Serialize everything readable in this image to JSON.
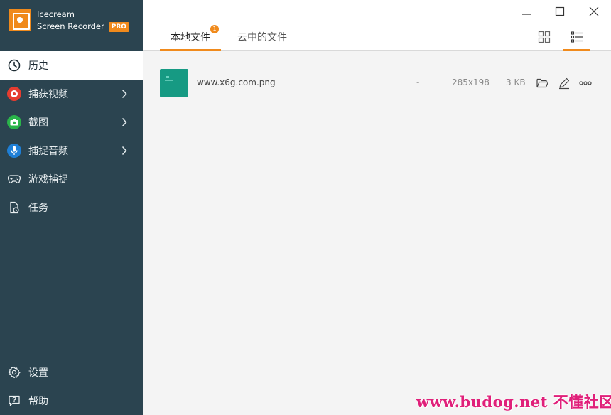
{
  "app": {
    "name_line1": "Icecream",
    "name_line2": "Screen Recorder",
    "pro_badge": "PRO"
  },
  "sidebar": {
    "items": [
      {
        "label": "历史",
        "icon": "clock-icon",
        "active": true
      },
      {
        "label": "捕获视频",
        "icon": "record-icon",
        "color": "#e63c2f",
        "has_submenu": true
      },
      {
        "label": "截图",
        "icon": "camera-icon",
        "color": "#2ab44a",
        "has_submenu": true
      },
      {
        "label": "捕捉音频",
        "icon": "microphone-icon",
        "color": "#1e7fd6",
        "has_submenu": true
      },
      {
        "label": "游戏捕捉",
        "icon": "gamepad-icon"
      },
      {
        "label": "任务",
        "icon": "task-icon"
      }
    ],
    "bottom_items": [
      {
        "label": "设置",
        "icon": "gear-icon"
      },
      {
        "label": "帮助",
        "icon": "help-icon"
      }
    ]
  },
  "tabs": [
    {
      "label": "本地文件",
      "active": true,
      "badge": "1"
    },
    {
      "label": "云中的文件",
      "active": false
    }
  ],
  "view_modes": [
    {
      "name": "grid-view-icon",
      "active": false
    },
    {
      "name": "list-view-icon",
      "active": true
    }
  ],
  "files": [
    {
      "name": "www.x6g.com.png",
      "duration": "-",
      "dimensions": "285x198",
      "size": "3 KB"
    }
  ],
  "colors": {
    "accent": "#f08a1c",
    "sidebar_bg": "#2b4450",
    "thumb": "#169a83"
  },
  "watermark": "www.budog.net 不懂社区"
}
